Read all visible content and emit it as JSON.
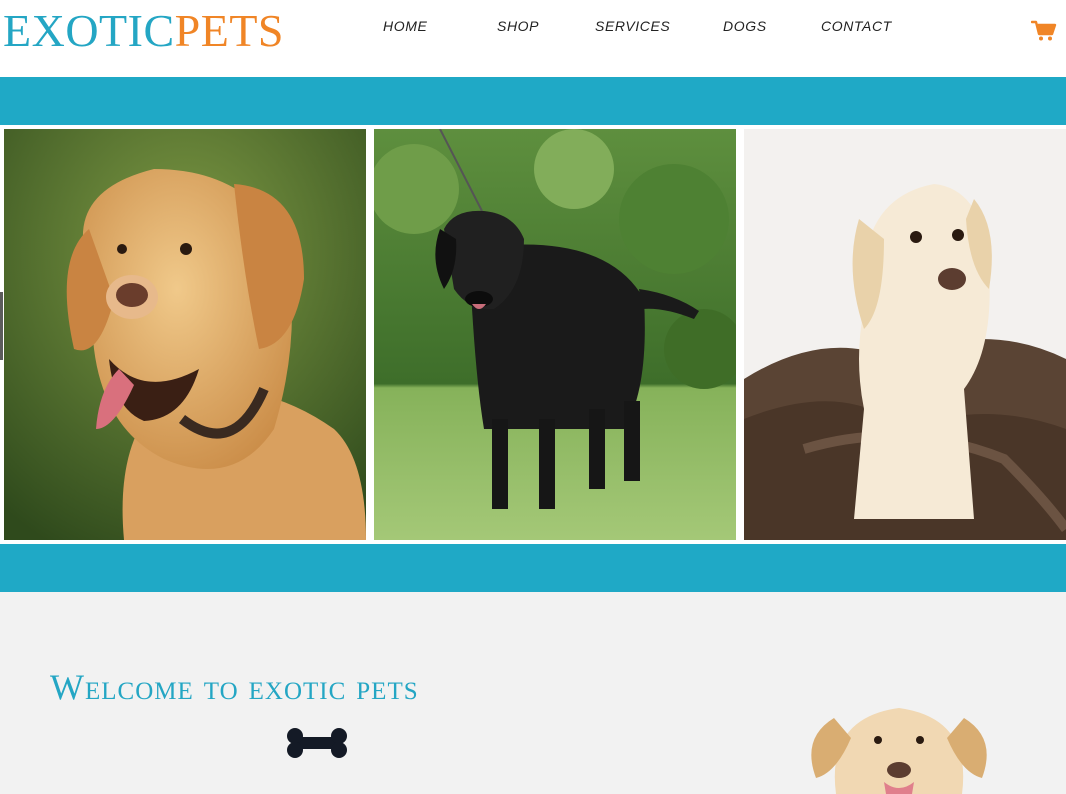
{
  "brand": {
    "part1": "EXOTIC",
    "part2": "PETS",
    "color1": "#24a6c4",
    "color2": "#f08526"
  },
  "nav": {
    "items": [
      {
        "label": "HOME",
        "name": "home"
      },
      {
        "label": "SHOP",
        "name": "shop"
      },
      {
        "label": "SERVICES",
        "name": "services"
      },
      {
        "label": "DOGS",
        "name": "dogs"
      },
      {
        "label": "CONTACT",
        "name": "contact"
      }
    ],
    "cart_icon": "shopping-cart-icon"
  },
  "theme": {
    "band": "#1fa9c6",
    "section_bg": "#f2f2f2"
  },
  "gallery": {
    "photos": [
      {
        "subject": "golden-labrador-photo"
      },
      {
        "subject": "black-labrador-photo"
      },
      {
        "subject": "yellow-labrador-puppy-photo"
      }
    ]
  },
  "welcome": {
    "title": "Welcome to exotic pets",
    "bone_icon": "bone-icon",
    "dog_image": "labrador-head-photo"
  }
}
